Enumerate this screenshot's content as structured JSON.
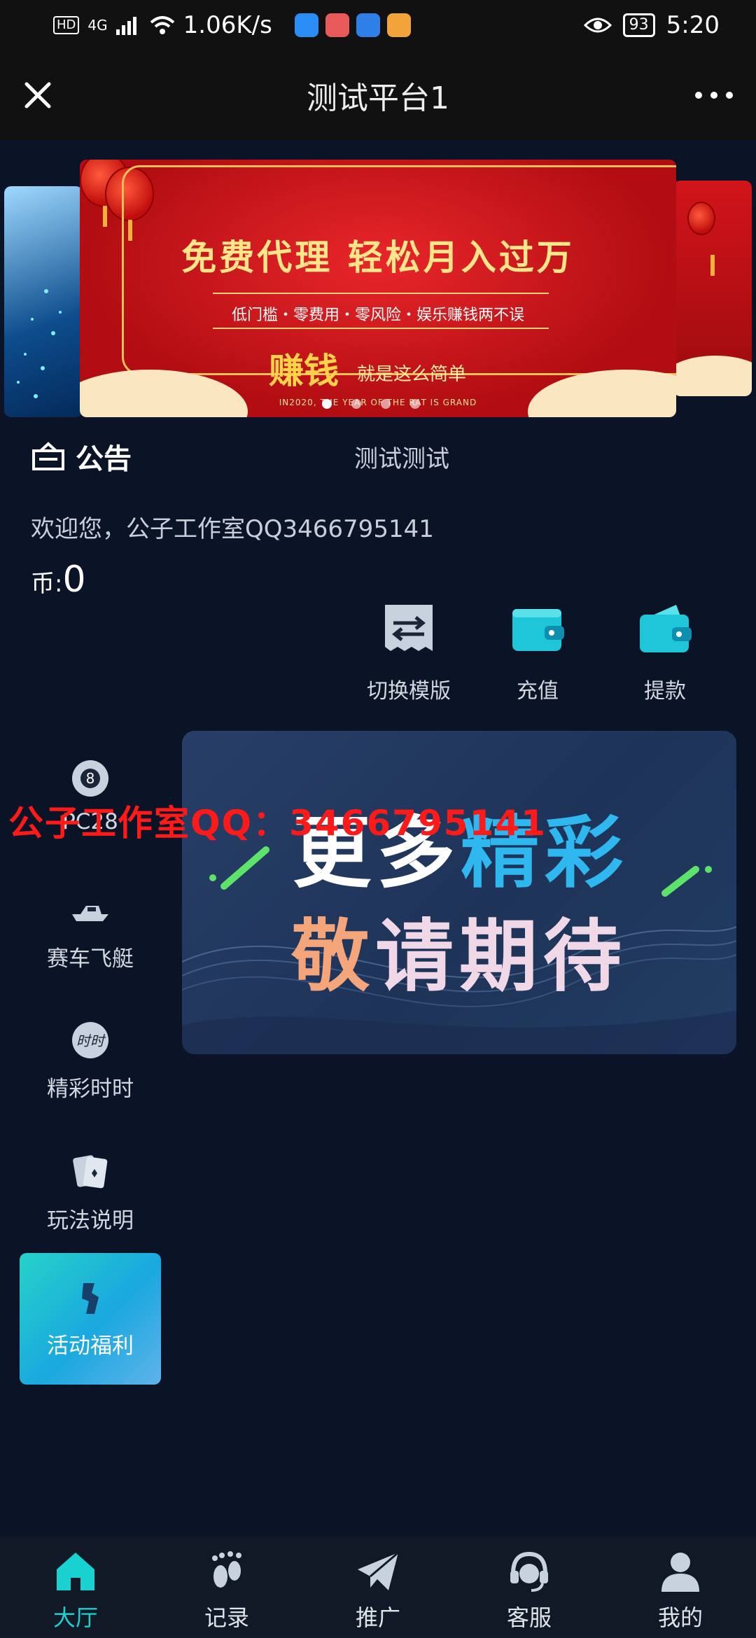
{
  "status_bar": {
    "hd": "HD",
    "signal": "4G",
    "speed": "1.06K/s",
    "battery": "93",
    "time": "5:20"
  },
  "nav": {
    "title": "测试平台1"
  },
  "banner": {
    "headline": "免费代理  轻松月入过万",
    "subline": "低门槛・零费用・零风险・娱乐赚钱两不误",
    "slogan_big": "赚钱",
    "slogan_small": "就是这么简单",
    "footer": "IN2020, THE YEAR OF THE RAT IS GRAND",
    "dots": 4,
    "active_dot": 0
  },
  "notice": {
    "label": "公告",
    "text": "测试测试"
  },
  "welcome": "欢迎您，公子工作室QQ3466795141",
  "balance": {
    "label": "币:",
    "value": "0"
  },
  "actions": [
    {
      "label": "切换模版",
      "icon": "switch-icon"
    },
    {
      "label": "充值",
      "icon": "wallet-icon"
    },
    {
      "label": "提款",
      "icon": "withdraw-icon"
    }
  ],
  "side_menu": [
    {
      "label": "PC28",
      "icon": "eight-ball-icon"
    },
    {
      "label": "赛车飞艇",
      "icon": "boat-icon"
    },
    {
      "label": "精彩时时",
      "icon": "shishi-icon"
    },
    {
      "label": "玩法说明",
      "icon": "cards-icon"
    },
    {
      "label": "活动福利",
      "icon": "gift-icon",
      "active": true
    }
  ],
  "promo": {
    "line1_a": "更多",
    "line1_b": "精彩",
    "line2_a": "敬",
    "line2_b": "请期待"
  },
  "watermark": "公子工作室QQ：3466795141",
  "tabs": [
    {
      "label": "大厅",
      "icon": "home-icon",
      "active": true
    },
    {
      "label": "记录",
      "icon": "footprint-icon"
    },
    {
      "label": "推广",
      "icon": "paper-plane-icon"
    },
    {
      "label": "客服",
      "icon": "headset-icon"
    },
    {
      "label": "我的",
      "icon": "user-icon"
    }
  ],
  "colors": {
    "background": "#0b1326",
    "accent": "#18d1d1",
    "banner_red": "#c8141a",
    "watermark": "#ff1a1a"
  }
}
